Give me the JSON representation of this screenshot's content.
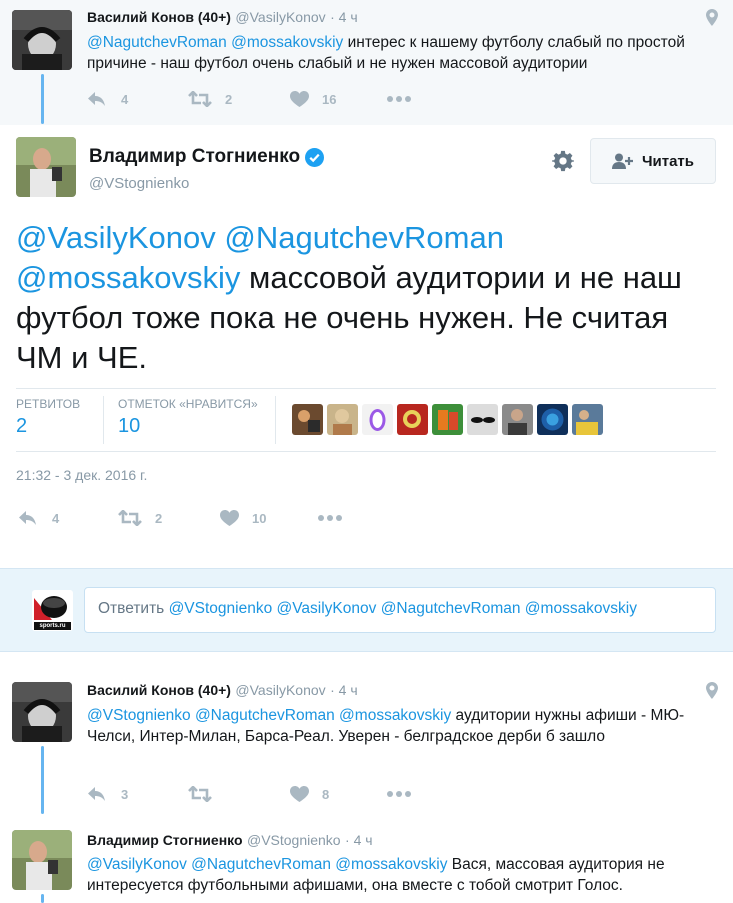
{
  "tweet1": {
    "name": "Василий Конов (40+)",
    "handle": "@VasilyKonov",
    "time": "4 ч",
    "mentions": "@NagutchevRoman @mossakovskiy",
    "text": " интерес к нашему футболу слабый по простой причине - наш футбол очень слабый и не нужен массовой аудитории",
    "replies": "4",
    "retweets": "2",
    "likes": "16"
  },
  "main": {
    "name": "Владимир Стогниенко",
    "handle": "@VStognienko",
    "follow_label": "Читать",
    "mentions": "@VasilyKonov @NagutchevRoman @mossakovskiy",
    "text": " массовой аудитории и не наш футбол тоже пока не очень нужен. Не считая ЧМ и ЧЕ.",
    "retweets_label": "РЕТВИТОВ",
    "retweets_count": "2",
    "likes_label": "ОТМЕТОК «НРАВИТСЯ»",
    "likes_count": "10",
    "timestamp": "21:32 - 3 дек. 2016 г.",
    "replies": "4",
    "retweets": "2",
    "likes": "10"
  },
  "reply_box": {
    "prefix": "Ответить ",
    "mentions": "@VStognienko @VasilyKonov @NagutchevRoman @mossakovskiy",
    "avatar_label": "sports.ru"
  },
  "tweet3": {
    "name": "Василий Конов (40+)",
    "handle": "@VasilyKonov",
    "time": "4 ч",
    "mentions": "@VStognienko @NagutchevRoman @mossakovskiy",
    "text": " аудитории нужны афиши - МЮ-Челси, Интер-Милан, Барса-Реал. Уверен - белградское дерби б зашло",
    "replies": "3",
    "retweets": "",
    "likes": "8"
  },
  "tweet4": {
    "name": "Владимир Стогниенко",
    "handle": "@VStognienko",
    "time": "4 ч",
    "mentions": "@VasilyKonov @NagutchevRoman @mossakovskiy",
    "text": " Вася, массовая аудитория не интересуется футбольными афишами, она вместе с тобой смотрит Голос."
  },
  "colors": {
    "link": "#1b95e0",
    "muted": "#8899a6",
    "thread": "#66b5f0",
    "icon": "#aab8c2"
  }
}
